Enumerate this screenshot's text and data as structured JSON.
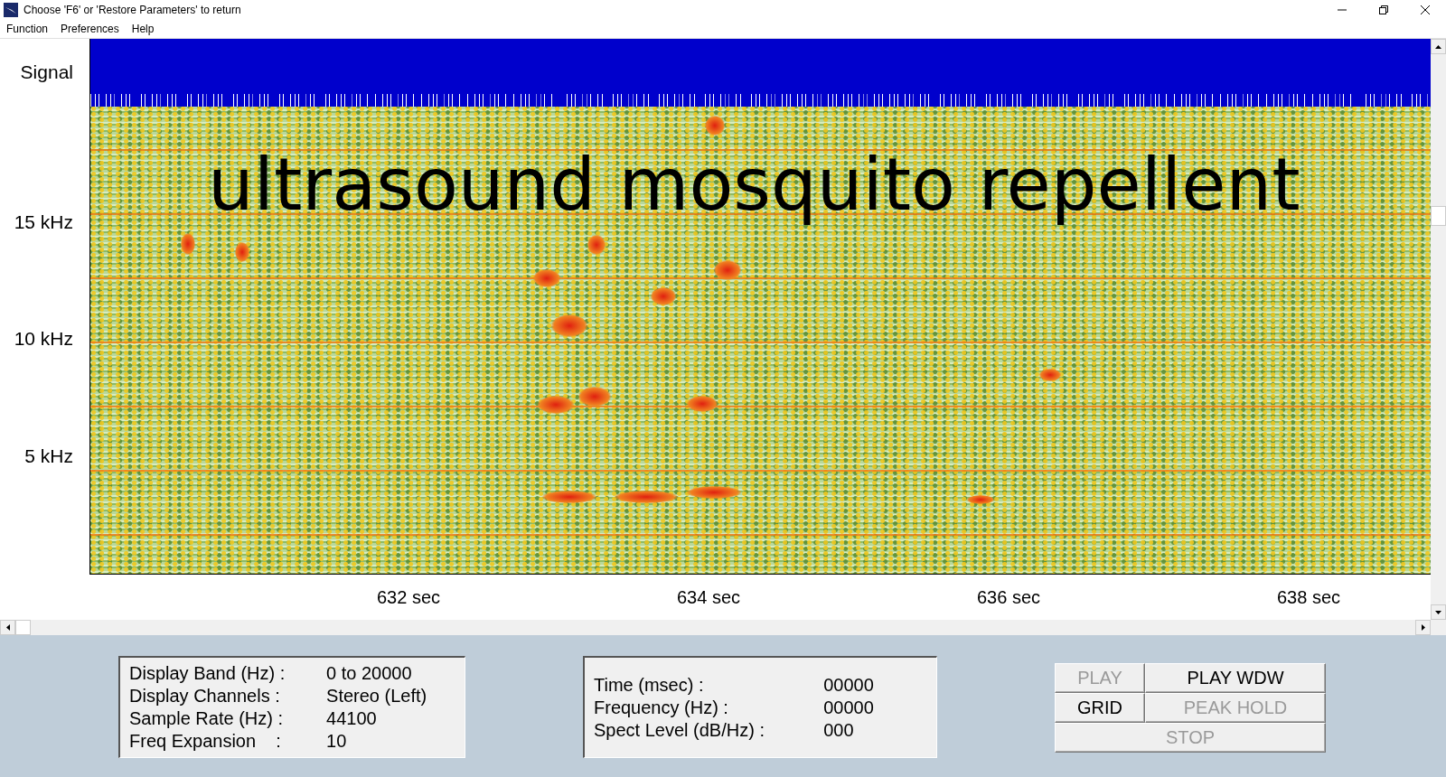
{
  "window": {
    "title": "Choose 'F6' or 'Restore Parameters' to return"
  },
  "menu": [
    "Function",
    "Preferences",
    "Help"
  ],
  "plot": {
    "signal_label": "Signal",
    "y_labels": [
      "15 kHz",
      "10 kHz",
      "5 kHz"
    ],
    "x_labels": [
      "632 sec",
      "634 sec",
      "636 sec",
      "638 sec"
    ],
    "overlay_caption": "ultrasound mosquito repellent"
  },
  "display_info": [
    {
      "label": "Display Band (Hz) :",
      "value": "0 to 20000"
    },
    {
      "label": "Display Channels :",
      "value": "Stereo (Left)"
    },
    {
      "label": "Sample Rate (Hz) :",
      "value": "44100"
    },
    {
      "label": "Freq Expansion    :",
      "value": "10"
    }
  ],
  "cursor_info": [
    {
      "label": "Time (msec) :",
      "value": "00000"
    },
    {
      "label": "Frequency (Hz) :",
      "value": "00000"
    },
    {
      "label": "Spect Level (dB/Hz) :",
      "value": "000"
    }
  ],
  "buttons": [
    {
      "label": "PLAY",
      "disabled": true
    },
    {
      "label": "PLAY WDW",
      "disabled": false
    },
    {
      "label": "GRID",
      "disabled": false
    },
    {
      "label": "PEAK HOLD",
      "disabled": true
    },
    {
      "label": "STOP",
      "disabled": true
    }
  ]
}
